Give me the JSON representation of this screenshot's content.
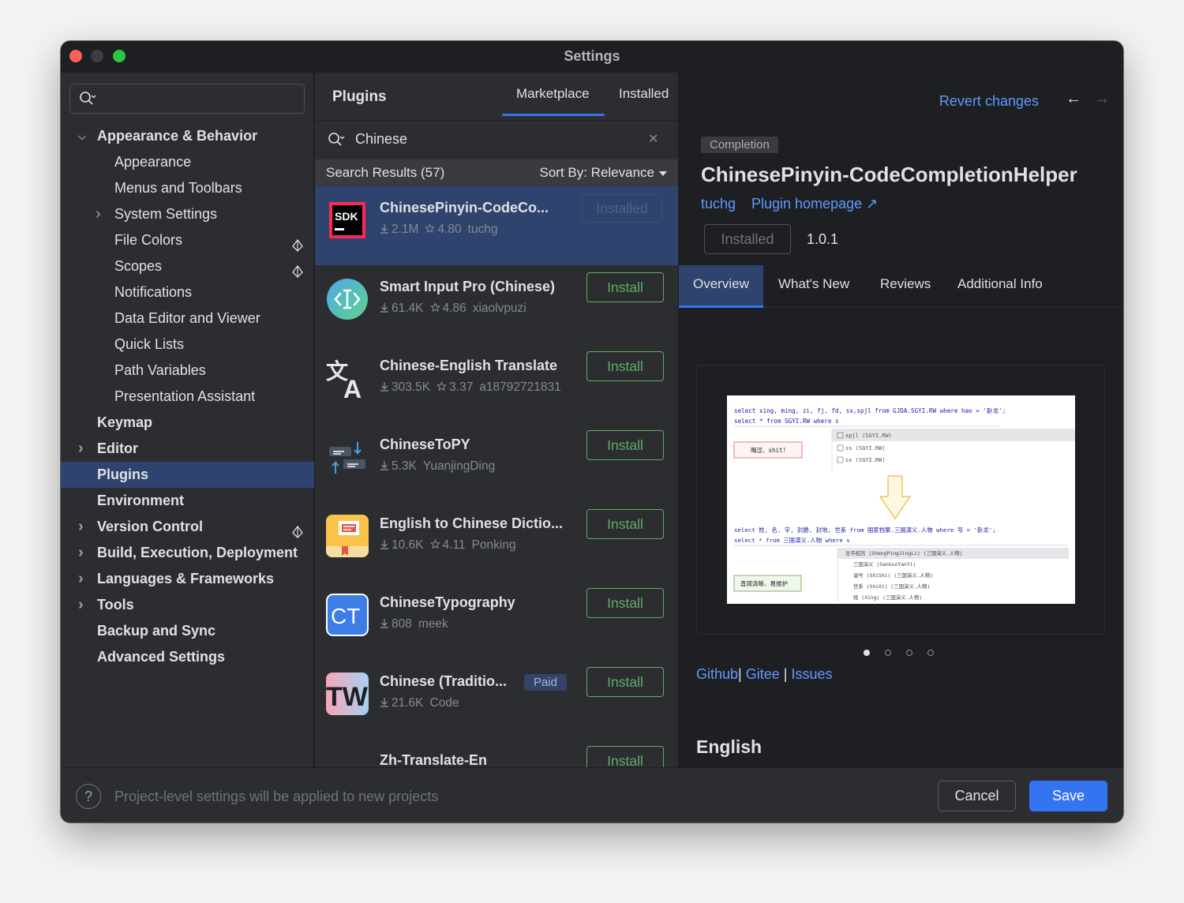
{
  "window": {
    "title": "Settings"
  },
  "sidebar": {
    "search_placeholder": "",
    "items": [
      {
        "label": "Appearance & Behavior",
        "level": "top",
        "expanded": true
      },
      {
        "label": "Appearance",
        "level": "sub"
      },
      {
        "label": "Menus and Toolbars",
        "level": "sub"
      },
      {
        "label": "System Settings",
        "level": "sub",
        "collapsed": true
      },
      {
        "label": "File Colors",
        "level": "sub",
        "project": true
      },
      {
        "label": "Scopes",
        "level": "sub",
        "project": true
      },
      {
        "label": "Notifications",
        "level": "sub"
      },
      {
        "label": "Data Editor and Viewer",
        "level": "sub"
      },
      {
        "label": "Quick Lists",
        "level": "sub"
      },
      {
        "label": "Path Variables",
        "level": "sub"
      },
      {
        "label": "Presentation Assistant",
        "level": "sub"
      },
      {
        "label": "Keymap",
        "level": "top"
      },
      {
        "label": "Editor",
        "level": "top",
        "collapsed": true
      },
      {
        "label": "Plugins",
        "level": "top",
        "selected": true
      },
      {
        "label": "Environment",
        "level": "top"
      },
      {
        "label": "Version Control",
        "level": "top",
        "collapsed": true,
        "project": true
      },
      {
        "label": "Build, Execution, Deployment",
        "level": "top",
        "collapsed": true
      },
      {
        "label": "Languages & Frameworks",
        "level": "top",
        "collapsed": true
      },
      {
        "label": "Tools",
        "level": "top",
        "collapsed": true
      },
      {
        "label": "Backup and Sync",
        "level": "top"
      },
      {
        "label": "Advanced Settings",
        "level": "top"
      }
    ]
  },
  "plugins": {
    "title": "Plugins",
    "tabs": {
      "marketplace": "Marketplace",
      "installed": "Installed"
    },
    "search_value": "Chinese",
    "results_label": "Search Results (57)",
    "sort_label": "Sort By: Relevance",
    "list": [
      {
        "name": "ChinesePinyin-CodeCo...",
        "downloads": "2.1M",
        "rating": "4.80",
        "vendor": "tuchg",
        "action": "Installed",
        "selected": true,
        "icon": "sdk-icon"
      },
      {
        "name": "Smart Input Pro (Chinese)",
        "downloads": "61.4K",
        "rating": "4.86",
        "vendor": "xiaolvpuzi",
        "action": "Install",
        "icon": "smart-input-icon"
      },
      {
        "name": "Chinese-English Translate",
        "downloads": "303.5K",
        "rating": "3.37",
        "vendor": "a18792721831",
        "action": "Install",
        "icon": "translate-icon"
      },
      {
        "name": "ChineseToPY",
        "downloads": "5.3K",
        "rating": "",
        "vendor": "YuanjingDing",
        "action": "Install",
        "icon": "convert-icon"
      },
      {
        "name": "English to Chinese Dictio...",
        "downloads": "10.6K",
        "rating": "4.11",
        "vendor": "Ponking",
        "action": "Install",
        "icon": "dictionary-icon"
      },
      {
        "name": "ChineseTypography",
        "downloads": "808",
        "rating": "",
        "vendor": "meek",
        "action": "Install",
        "icon": "ct-icon"
      },
      {
        "name": "Chinese (Traditio...",
        "downloads": "21.6K",
        "rating": "",
        "vendor": "Code",
        "action": "Install",
        "badge": "Paid",
        "icon": "tw-icon"
      },
      {
        "name": "Zh-Translate-En",
        "downloads": "",
        "rating": "",
        "vendor": "",
        "action": "Install",
        "icon": "zh-translate-icon"
      }
    ]
  },
  "detail": {
    "revert_label": "Revert changes",
    "tag": "Completion",
    "name": "ChinesePinyin-CodeCompletionHelper",
    "vendor": "tuchg",
    "homepage": "Plugin homepage ↗",
    "installed_label": "Installed",
    "version": "1.0.1",
    "tabs": [
      "Overview",
      "What's New",
      "Reviews",
      "Additional Info"
    ],
    "links": {
      "github": "Github",
      "gitee": "Gitee",
      "issues": "Issues",
      "sep": "|"
    },
    "section_heading": "English",
    "screenshot": {
      "line1": "select xing, ming, zi, fj, fd, sx,spjl from GJDA.SGYI.RW where hao = '卧龙';",
      "line2": "select * from SGYI.RW where s",
      "pop1": [
        "spjl (SGYI.RW)",
        "ss (SGYI.RW)",
        "sx (SGYI.RW)"
      ],
      "note1": "晦涩、shit!",
      "line3": "select 姓, 名, 字, 封爵, 封地, 世系 from 国家档案.三国演义.人物 where 号 = '卧龙';",
      "line4": "select * from 三国演义.人物 where s",
      "pop2": [
        "生平经历 (ShengPingJingLi) (三国演义.人物)",
        "三国演义 (SanGuoYanYi)",
        "谥号 (ShiShi) (三国演义.人物)",
        "世系 (ShiXi) (三国演义.人物)",
        "姓 (Xing) (三国演义.人物)"
      ],
      "note2": "直观清晰、易维护"
    }
  },
  "footer": {
    "help": "?",
    "text": "Project-level settings will be applied to new projects",
    "cancel": "Cancel",
    "save": "Save"
  },
  "colors": {
    "accent": "#3574f0",
    "link": "#5e9bff",
    "install_green": "#5fad65",
    "selection": "#2e436e"
  }
}
